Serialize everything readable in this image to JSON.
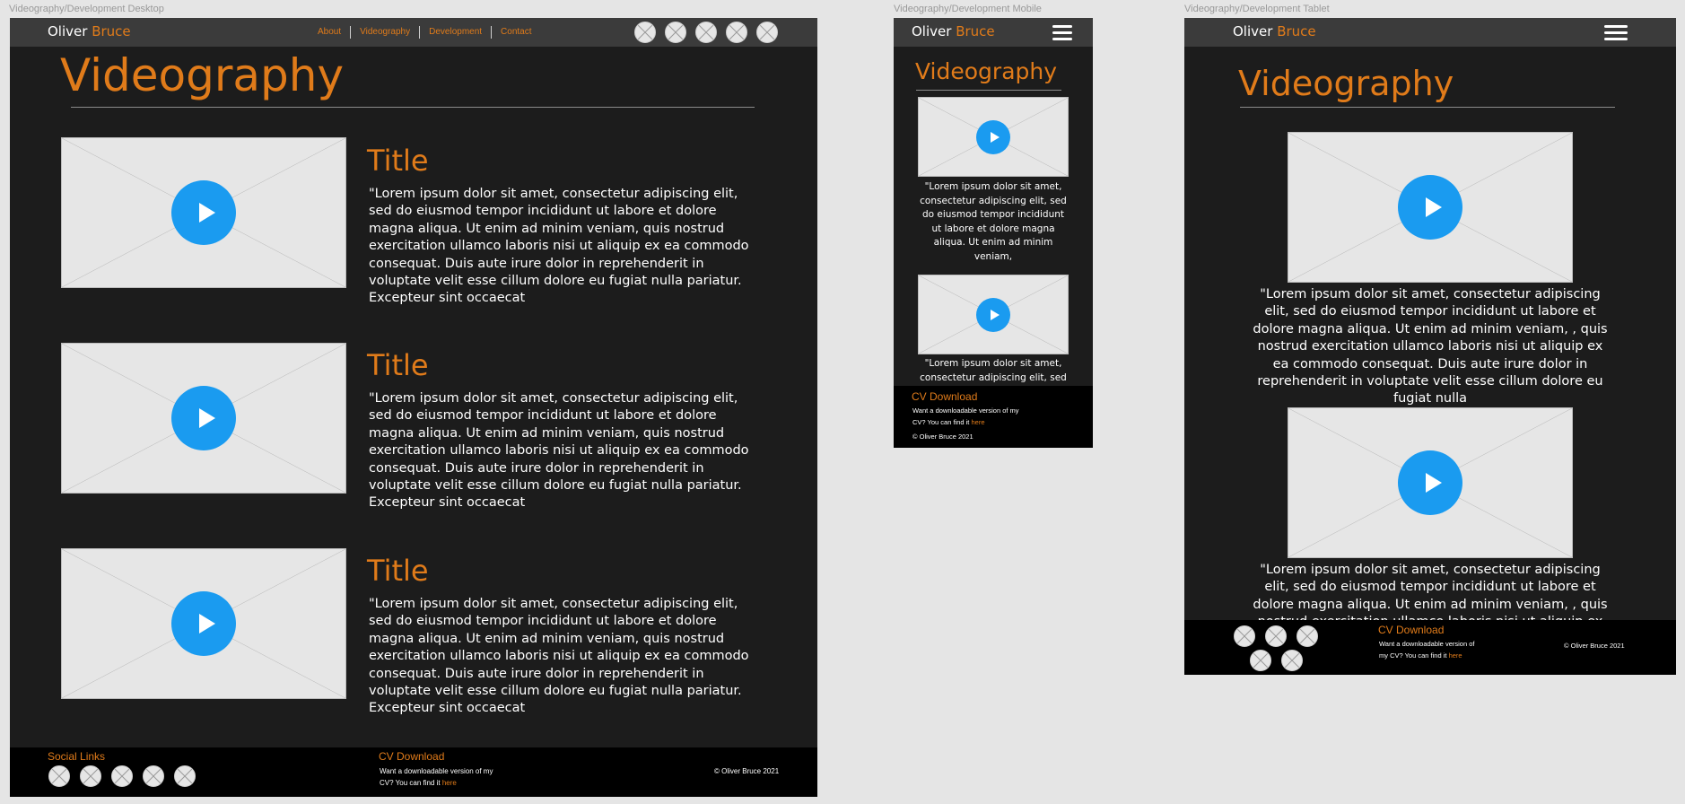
{
  "frames": {
    "desktop_label": "Videography/Development Desktop",
    "mobile_label": "Videography/Development Mobile",
    "tablet_label": "Videography/Development Tablet"
  },
  "brand": {
    "first": "Oliver",
    "last": "Bruce"
  },
  "nav": {
    "links": [
      "About",
      "Videography",
      "Development",
      "Contact"
    ]
  },
  "heading": "Videography",
  "desktop": {
    "items": [
      {
        "title": "Title",
        "text": "\"Lorem ipsum dolor sit amet, consectetur adipiscing elit, sed do eiusmod tempor incididunt ut labore et dolore magna aliqua. Ut enim ad minim veniam, quis nostrud exercitation ullamco laboris nisi ut aliquip ex ea commodo consequat. Duis aute irure dolor in reprehenderit in voluptate velit esse cillum dolore eu fugiat nulla pariatur. Excepteur sint occaecat"
      },
      {
        "title": "Title",
        "text": "\"Lorem ipsum dolor sit amet, consectetur adipiscing elit, sed do eiusmod tempor incididunt ut labore et dolore magna aliqua. Ut enim ad minim veniam, quis nostrud exercitation ullamco laboris nisi ut aliquip ex ea commodo consequat. Duis aute irure dolor in reprehenderit in voluptate velit esse cillum dolore eu fugiat nulla pariatur. Excepteur sint occaecat"
      },
      {
        "title": "Title",
        "text": "\"Lorem ipsum dolor sit amet, consectetur adipiscing elit, sed do eiusmod tempor incididunt ut labore et dolore magna aliqua. Ut enim ad minim veniam, quis nostrud exercitation ullamco laboris nisi ut aliquip ex ea commodo consequat. Duis aute irure dolor in reprehenderit in voluptate velit esse cillum dolore eu fugiat nulla pariatur. Excepteur sint occaecat"
      }
    ]
  },
  "mobile": {
    "text1": "\"Lorem ipsum dolor sit amet, consectetur adipiscing elit, sed do eiusmod tempor incididunt ut labore et dolore magna aliqua. Ut enim ad minim veniam,",
    "text2": "\"Lorem ipsum dolor sit amet, consectetur adipiscing elit, sed do eiusmod tempor incididunt ut labore et dolore magna aliqua. Ut enim ad minim veniam,"
  },
  "tablet": {
    "text1": "\"Lorem ipsum dolor sit amet, consectetur adipiscing elit, sed do eiusmod tempor incididunt ut labore et dolore magna aliqua. Ut enim ad minim veniam, , quis nostrud exercitation ullamco laboris nisi ut aliquip ex ea commodo consequat. Duis aute irure dolor in reprehenderit in voluptate velit esse cillum dolore eu fugiat nulla",
    "text2": "\"Lorem ipsum dolor sit amet, consectetur adipiscing elit, sed do eiusmod tempor incididunt ut labore et dolore magna aliqua. Ut enim ad minim veniam, , quis nostrud exercitation ullamco laboris nisi ut aliquip ex ea commodo consequat. Duis aute irure dolor in reprehenderit in voluptate velit esse cillum dolore eu fugiat nulla"
  },
  "footer": {
    "social_title": "Social Links",
    "cv_title": "CV Download",
    "cv_text": "Want a downloadable version of my CV? You can find it",
    "cv_link": "here",
    "copyright": "© Oliver Bruce 2021"
  },
  "colors": {
    "accent": "#e07b1a",
    "play": "#1a9bf0",
    "bg": "#1c1c1c",
    "nav": "#3b3b3b",
    "footer": "#000000"
  },
  "icons": {
    "social": "placeholder-x-icon",
    "play": "play-icon",
    "menu": "hamburger-menu-icon"
  }
}
